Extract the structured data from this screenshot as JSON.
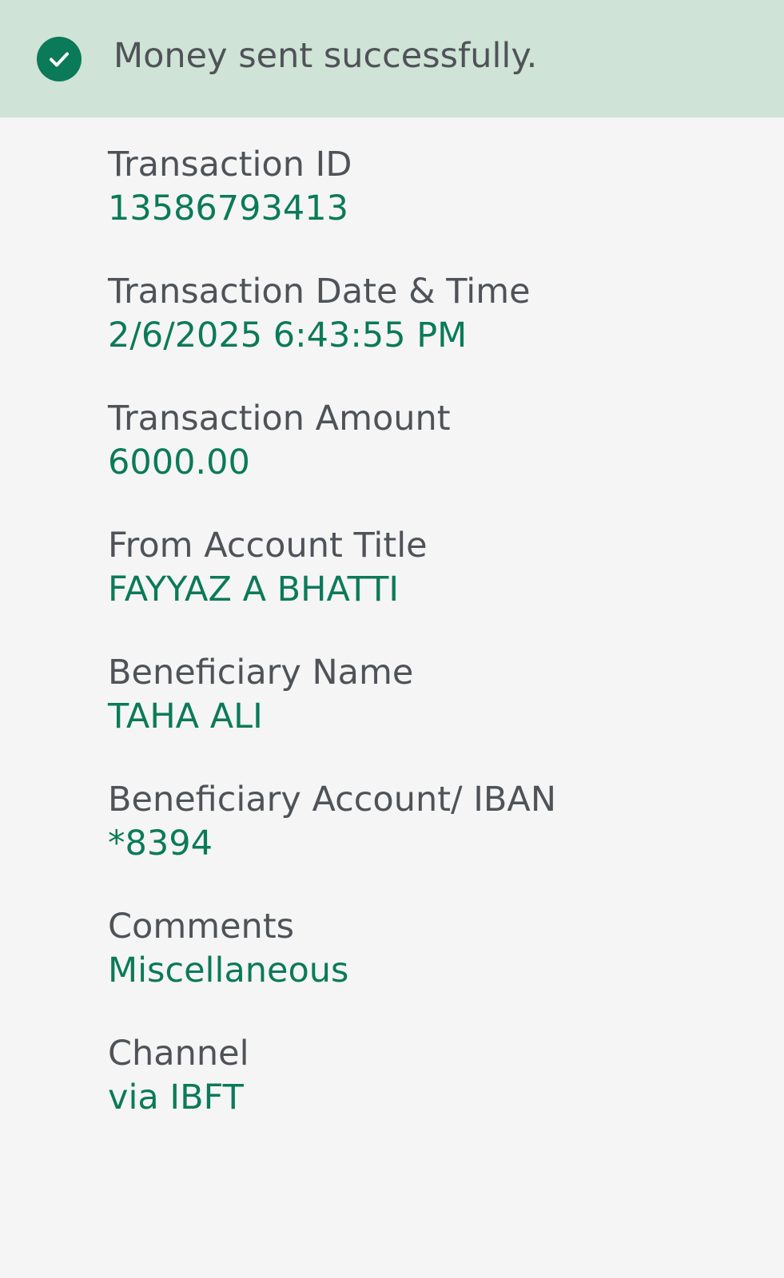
{
  "banner": {
    "message": "Money sent successfully.",
    "icon": "check-circle-icon"
  },
  "details": [
    {
      "label": "Transaction ID",
      "value": "13586793413"
    },
    {
      "label": "Transaction Date & Time",
      "value": "2/6/2025 6:43:55 PM"
    },
    {
      "label": "Transaction Amount",
      "value": "6000.00"
    },
    {
      "label": "From Account Title",
      "value": "FAYYAZ A BHATTI"
    },
    {
      "label": "Beneficiary Name",
      "value": "TAHA ALI"
    },
    {
      "label": "Beneficiary Account/ IBAN",
      "value": "*8394"
    },
    {
      "label": "Comments",
      "value": "Miscellaneous"
    },
    {
      "label": "Channel",
      "value": "via IBFT"
    }
  ],
  "colors": {
    "banner_bg": "#cfe3d6",
    "accent": "#0b7a58",
    "label": "#4f5358",
    "page_bg": "#f5f5f5"
  }
}
